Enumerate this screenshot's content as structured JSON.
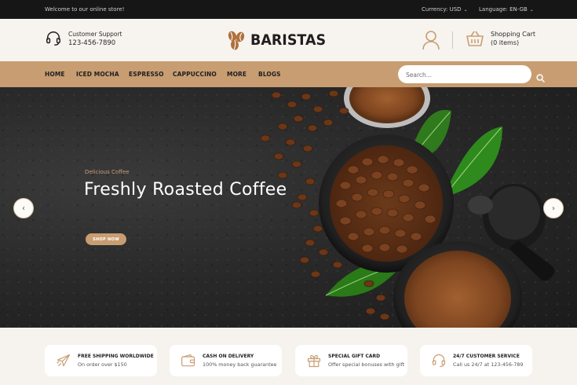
{
  "topbar": {
    "welcome": "Welcome to our online store!",
    "currency_label": "Currency: USD",
    "language_label": "Language: EN-GB"
  },
  "header": {
    "support_label": "Customer Support",
    "support_phone": "123-456-7890",
    "logo_text": "BARISTAS",
    "cart_label": "Shopping Cart",
    "cart_count": "(0 items)"
  },
  "nav": {
    "items": [
      "HOME",
      "ICED MOCHA",
      "ESPRESSO",
      "CAPPUCCINO",
      "MORE",
      "BLOGS"
    ],
    "search_placeholder": "Search..."
  },
  "hero": {
    "eyebrow": "Delicious Coffee",
    "title": "Freshly Roasted Coffee",
    "button": "SHOP NOW"
  },
  "features": [
    {
      "icon": "plane-icon",
      "title": "FREE SHIPPING WORLDWIDE",
      "subtitle": "On order over $150"
    },
    {
      "icon": "wallet-icon",
      "title": "CASH ON DELIVERY",
      "subtitle": "100% money back guarantee"
    },
    {
      "icon": "gift-icon",
      "title": "SPECIAL GIFT CARD",
      "subtitle": "Offer special bonuses with gift"
    },
    {
      "icon": "headset-icon",
      "title": "24/7 CUSTOMER SERVICE",
      "subtitle": "Call us 24/7 at 123-456-789"
    }
  ],
  "colors": {
    "accent": "#c89d72",
    "topbar_bg": "#161616",
    "header_bg": "#f7f4ef"
  }
}
